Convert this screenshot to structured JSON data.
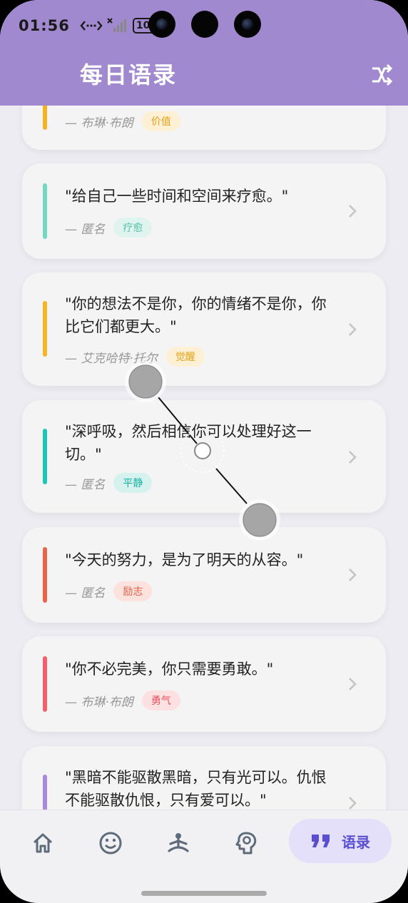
{
  "status": {
    "time": "01:56",
    "battery": "100"
  },
  "header": {
    "title": "每日语录"
  },
  "cards": [
    {
      "author": "— 布琳·布朗",
      "tag": "价值",
      "bar_color": "#f5b324",
      "tag_bg": "#fdf0d4",
      "tag_color": "#e6a21a"
    },
    {
      "quote": "\"给自己一些时间和空间来疗愈。\"",
      "author": "— 匿名",
      "tag": "疗愈",
      "bar_color": "#76d7c4",
      "tag_bg": "#dff4ee",
      "tag_color": "#52c0a8"
    },
    {
      "quote": "\"你的想法不是你，你的情绪不是你，你比它们都更大。\"",
      "author": "— 艾克哈特·托尔",
      "tag": "觉醒",
      "bar_color": "#f7b52b",
      "tag_bg": "#fdf0d4",
      "tag_color": "#e6a21a"
    },
    {
      "quote": "\"深呼吸，然后相信你可以处理好这一切。\"",
      "author": "— 匿名",
      "tag": "平静",
      "bar_color": "#1cc5b5",
      "tag_bg": "#d6f2ee",
      "tag_color": "#18b0a2"
    },
    {
      "quote": "\"今天的努力，是为了明天的从容。\"",
      "author": "— 匿名",
      "tag": "励志",
      "bar_color": "#e8654d",
      "tag_bg": "#fbe2dd",
      "tag_color": "#e0604a"
    },
    {
      "quote": "\"你不必完美，你只需要勇敢。\"",
      "author": "— 布琳·布朗",
      "tag": "勇气",
      "bar_color": "#f2606b",
      "tag_bg": "#fde0e2",
      "tag_color": "#e8505c"
    },
    {
      "quote": "\"黑暗不能驱散黑暗，只有光可以。仇恨不能驱散仇恨，只有爱可以。\"",
      "bar_color": "#a98ad8"
    }
  ],
  "nav": {
    "active_label": "语录",
    "items": [
      "home-icon",
      "smile-icon",
      "meditation-icon",
      "brain-icon",
      "quote-icon"
    ]
  },
  "colors": {
    "header": "#a189d0",
    "active_tab_bg": "#e4e0fa",
    "active_tab_text": "#5a4fd0"
  }
}
